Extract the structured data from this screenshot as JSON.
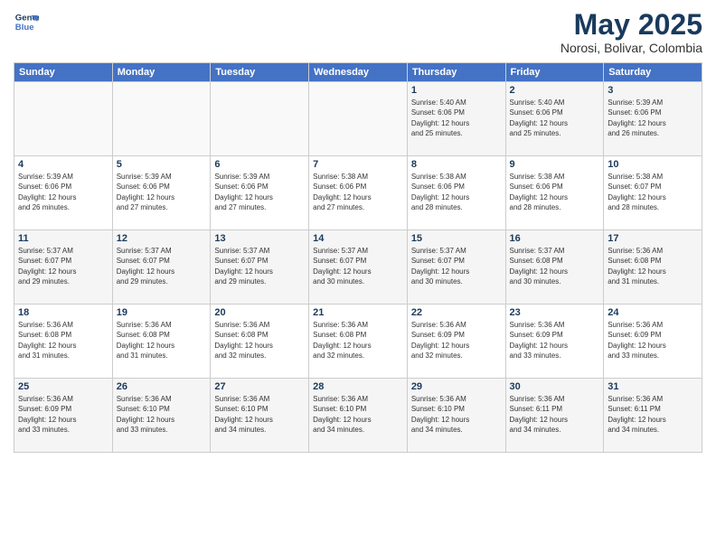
{
  "header": {
    "logo_line1": "General",
    "logo_line2": "Blue",
    "title": "May 2025",
    "subtitle": "Norosi, Bolivar, Colombia"
  },
  "days_of_week": [
    "Sunday",
    "Monday",
    "Tuesday",
    "Wednesday",
    "Thursday",
    "Friday",
    "Saturday"
  ],
  "weeks": [
    [
      {
        "num": "",
        "text": ""
      },
      {
        "num": "",
        "text": ""
      },
      {
        "num": "",
        "text": ""
      },
      {
        "num": "",
        "text": ""
      },
      {
        "num": "1",
        "text": "Sunrise: 5:40 AM\nSunset: 6:06 PM\nDaylight: 12 hours\nand 25 minutes."
      },
      {
        "num": "2",
        "text": "Sunrise: 5:40 AM\nSunset: 6:06 PM\nDaylight: 12 hours\nand 25 minutes."
      },
      {
        "num": "3",
        "text": "Sunrise: 5:39 AM\nSunset: 6:06 PM\nDaylight: 12 hours\nand 26 minutes."
      }
    ],
    [
      {
        "num": "4",
        "text": "Sunrise: 5:39 AM\nSunset: 6:06 PM\nDaylight: 12 hours\nand 26 minutes."
      },
      {
        "num": "5",
        "text": "Sunrise: 5:39 AM\nSunset: 6:06 PM\nDaylight: 12 hours\nand 27 minutes."
      },
      {
        "num": "6",
        "text": "Sunrise: 5:39 AM\nSunset: 6:06 PM\nDaylight: 12 hours\nand 27 minutes."
      },
      {
        "num": "7",
        "text": "Sunrise: 5:38 AM\nSunset: 6:06 PM\nDaylight: 12 hours\nand 27 minutes."
      },
      {
        "num": "8",
        "text": "Sunrise: 5:38 AM\nSunset: 6:06 PM\nDaylight: 12 hours\nand 28 minutes."
      },
      {
        "num": "9",
        "text": "Sunrise: 5:38 AM\nSunset: 6:06 PM\nDaylight: 12 hours\nand 28 minutes."
      },
      {
        "num": "10",
        "text": "Sunrise: 5:38 AM\nSunset: 6:07 PM\nDaylight: 12 hours\nand 28 minutes."
      }
    ],
    [
      {
        "num": "11",
        "text": "Sunrise: 5:37 AM\nSunset: 6:07 PM\nDaylight: 12 hours\nand 29 minutes."
      },
      {
        "num": "12",
        "text": "Sunrise: 5:37 AM\nSunset: 6:07 PM\nDaylight: 12 hours\nand 29 minutes."
      },
      {
        "num": "13",
        "text": "Sunrise: 5:37 AM\nSunset: 6:07 PM\nDaylight: 12 hours\nand 29 minutes."
      },
      {
        "num": "14",
        "text": "Sunrise: 5:37 AM\nSunset: 6:07 PM\nDaylight: 12 hours\nand 30 minutes."
      },
      {
        "num": "15",
        "text": "Sunrise: 5:37 AM\nSunset: 6:07 PM\nDaylight: 12 hours\nand 30 minutes."
      },
      {
        "num": "16",
        "text": "Sunrise: 5:37 AM\nSunset: 6:08 PM\nDaylight: 12 hours\nand 30 minutes."
      },
      {
        "num": "17",
        "text": "Sunrise: 5:36 AM\nSunset: 6:08 PM\nDaylight: 12 hours\nand 31 minutes."
      }
    ],
    [
      {
        "num": "18",
        "text": "Sunrise: 5:36 AM\nSunset: 6:08 PM\nDaylight: 12 hours\nand 31 minutes."
      },
      {
        "num": "19",
        "text": "Sunrise: 5:36 AM\nSunset: 6:08 PM\nDaylight: 12 hours\nand 31 minutes."
      },
      {
        "num": "20",
        "text": "Sunrise: 5:36 AM\nSunset: 6:08 PM\nDaylight: 12 hours\nand 32 minutes."
      },
      {
        "num": "21",
        "text": "Sunrise: 5:36 AM\nSunset: 6:08 PM\nDaylight: 12 hours\nand 32 minutes."
      },
      {
        "num": "22",
        "text": "Sunrise: 5:36 AM\nSunset: 6:09 PM\nDaylight: 12 hours\nand 32 minutes."
      },
      {
        "num": "23",
        "text": "Sunrise: 5:36 AM\nSunset: 6:09 PM\nDaylight: 12 hours\nand 33 minutes."
      },
      {
        "num": "24",
        "text": "Sunrise: 5:36 AM\nSunset: 6:09 PM\nDaylight: 12 hours\nand 33 minutes."
      }
    ],
    [
      {
        "num": "25",
        "text": "Sunrise: 5:36 AM\nSunset: 6:09 PM\nDaylight: 12 hours\nand 33 minutes."
      },
      {
        "num": "26",
        "text": "Sunrise: 5:36 AM\nSunset: 6:10 PM\nDaylight: 12 hours\nand 33 minutes."
      },
      {
        "num": "27",
        "text": "Sunrise: 5:36 AM\nSunset: 6:10 PM\nDaylight: 12 hours\nand 34 minutes."
      },
      {
        "num": "28",
        "text": "Sunrise: 5:36 AM\nSunset: 6:10 PM\nDaylight: 12 hours\nand 34 minutes."
      },
      {
        "num": "29",
        "text": "Sunrise: 5:36 AM\nSunset: 6:10 PM\nDaylight: 12 hours\nand 34 minutes."
      },
      {
        "num": "30",
        "text": "Sunrise: 5:36 AM\nSunset: 6:11 PM\nDaylight: 12 hours\nand 34 minutes."
      },
      {
        "num": "31",
        "text": "Sunrise: 5:36 AM\nSunset: 6:11 PM\nDaylight: 12 hours\nand 34 minutes."
      }
    ]
  ]
}
